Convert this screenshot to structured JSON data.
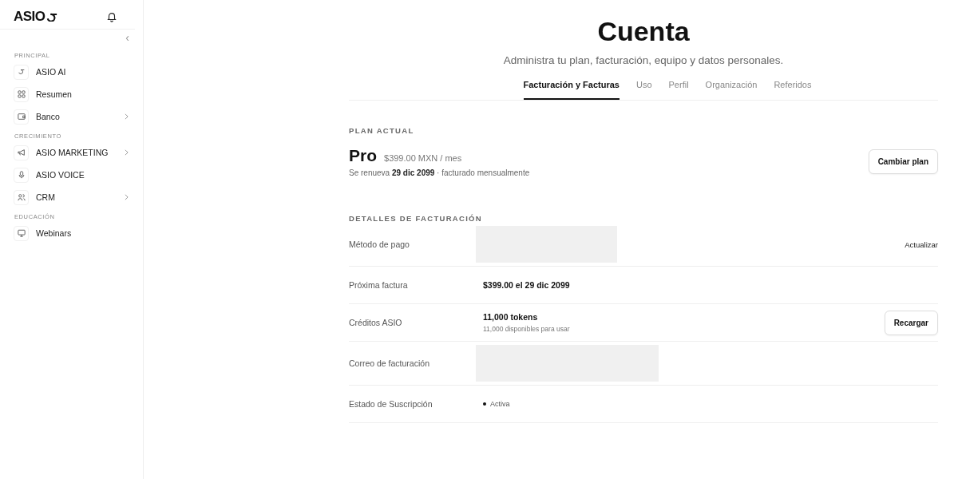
{
  "sidebar": {
    "logo": "ASIO",
    "collapse_icon": "‹",
    "sections": [
      {
        "title": "PRINCIPAL",
        "items": [
          {
            "label": "ASIO AI",
            "has_submenu": false
          },
          {
            "label": "Resumen",
            "has_submenu": false
          },
          {
            "label": "Banco",
            "has_submenu": true
          }
        ]
      },
      {
        "title": "CRECIMIENTO",
        "items": [
          {
            "label": "ASIO MARKETING",
            "has_submenu": true
          },
          {
            "label": "ASIO VOICE",
            "has_submenu": false
          },
          {
            "label": "CRM",
            "has_submenu": true
          }
        ]
      },
      {
        "title": "EDUCACIÓN",
        "items": [
          {
            "label": "Webinars",
            "has_submenu": false
          }
        ]
      }
    ]
  },
  "page": {
    "title": "Cuenta",
    "subtitle": "Administra tu plan, facturación, equipo y datos personales."
  },
  "tabs": [
    {
      "label": "Facturación y Facturas",
      "selected": true
    },
    {
      "label": "Uso",
      "selected": false
    },
    {
      "label": "Perfil",
      "selected": false
    },
    {
      "label": "Organización",
      "selected": false
    },
    {
      "label": "Referidos",
      "selected": false
    }
  ],
  "plan": {
    "heading": "PLAN ACTUAL",
    "name": "Pro",
    "price": "$399.00 MXN / mes",
    "renewal": "Se renueva **29 dic 2099** · facturado mensualmente",
    "button": "Cambiar plan"
  },
  "billing": {
    "heading": "DETALLES DE FACTURACIÓN",
    "rows": [
      {
        "kind": "hidden",
        "label": "Método de pago",
        "link": "Actualizar"
      },
      {
        "kind": "text",
        "label": "Próxima factura",
        "value": "$399.00 el 29 dic 2099"
      },
      {
        "kind": "text",
        "label": "Créditos ASIO",
        "value": "11,000 tokens",
        "note": "11,000 disponibles para usar",
        "button": "Recargar"
      },
      {
        "kind": "hidden",
        "label": "Correo de facturación"
      },
      {
        "kind": "status",
        "label": "Estado de Suscripción",
        "value": "Activa",
        "color": "#111111"
      }
    ]
  }
}
